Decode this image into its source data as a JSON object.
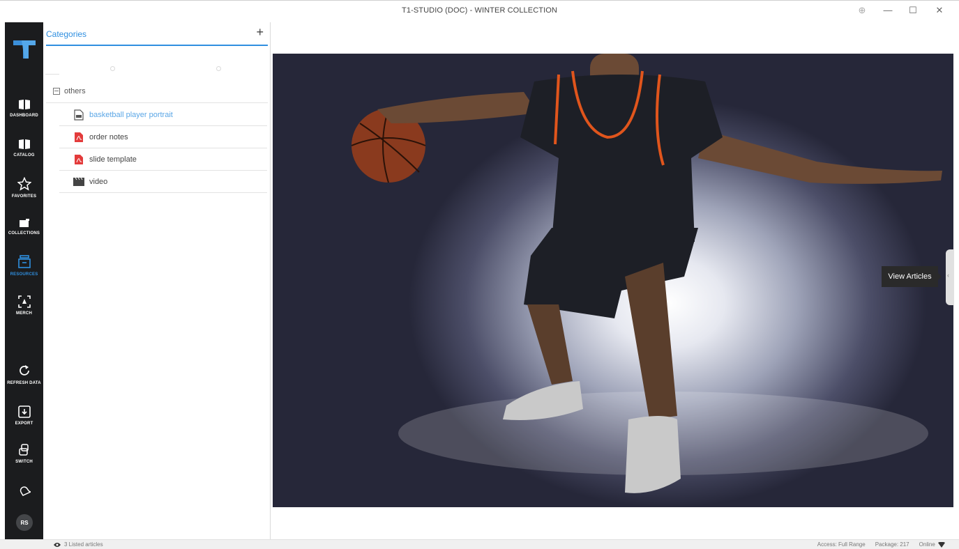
{
  "window": {
    "title": "T1-STUDIO (DOC) - WINTER COLLECTION",
    "zoom_glyph": "⊕",
    "minimize_glyph": "—",
    "maximize_glyph": "☐",
    "close_glyph": "✕"
  },
  "nav": {
    "logo_icon": "t1-logo-icon",
    "items": [
      {
        "label": "DASHBOARD",
        "icon": "book-icon",
        "active": false
      },
      {
        "label": "CATALOG",
        "icon": "book-icon",
        "active": false
      },
      {
        "label": "FAVORITES",
        "icon": "star-icon",
        "active": false
      },
      {
        "label": "COLLECTIONS",
        "icon": "folder-icon",
        "active": false
      },
      {
        "label": "RESOURCES",
        "icon": "archive-icon",
        "active": true
      },
      {
        "label": "MERCH",
        "icon": "focus-icon",
        "active": false
      },
      {
        "label": "REFRESH DATA",
        "icon": "refresh-icon",
        "active": false
      },
      {
        "label": "EXPORT",
        "icon": "download-box-icon",
        "active": false
      },
      {
        "label": "SWITCH",
        "icon": "switch-icon",
        "active": false
      }
    ],
    "bell_icon": "bell-icon",
    "avatar_initials": "RS",
    "active_color": "#2f8fe0"
  },
  "categories": {
    "title": "Categories",
    "add_label": "+",
    "group": {
      "label": "others",
      "items": [
        {
          "label": "basketball player portrait",
          "icon": "image-file-icon",
          "selected": true
        },
        {
          "label": "order notes",
          "icon": "pdf-file-icon",
          "selected": false
        },
        {
          "label": "slide template",
          "icon": "pdf-file-icon",
          "selected": false
        },
        {
          "label": "video",
          "icon": "video-clapper-icon",
          "selected": false
        }
      ]
    }
  },
  "viewer": {
    "tooltip": "View Articles",
    "handle_glyph": "‹"
  },
  "status": {
    "listed": "3 Listed articles",
    "access": "Access: Full Range",
    "package": "Package: 217",
    "online": "Online"
  }
}
